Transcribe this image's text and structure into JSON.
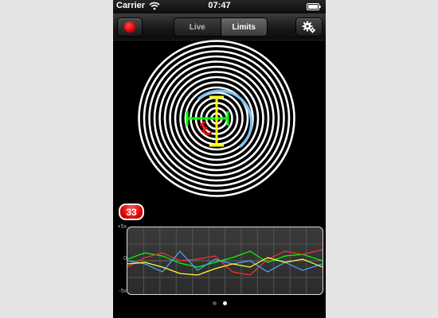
{
  "status_bar": {
    "carrier": "Carrier",
    "time": "07:47"
  },
  "toolbar": {
    "record_icon": "record-dot-icon",
    "settings_icon": "gear-icon",
    "tabs": [
      {
        "label": "Live",
        "active": false
      },
      {
        "label": "Limits",
        "active": true
      }
    ]
  },
  "target": {
    "ring_color": "#ffffff",
    "ring_count": 15,
    "crosshair_horizontal_color": "#00ff00",
    "crosshair_vertical_color": "#ffff00",
    "arc_color": "#7fc4f2",
    "trace_color": "#ff0000"
  },
  "badge": {
    "count": "33",
    "color": "#e00000"
  },
  "graph": {
    "y_top_label": "+5x",
    "y_mid_label": "0",
    "y_bottom_label": "-5x",
    "series_colors": [
      "#00ff00",
      "#ff3030",
      "#4aa8ff",
      "#ffff40"
    ]
  },
  "page_indicator": {
    "count": 2,
    "active_index": 1
  }
}
